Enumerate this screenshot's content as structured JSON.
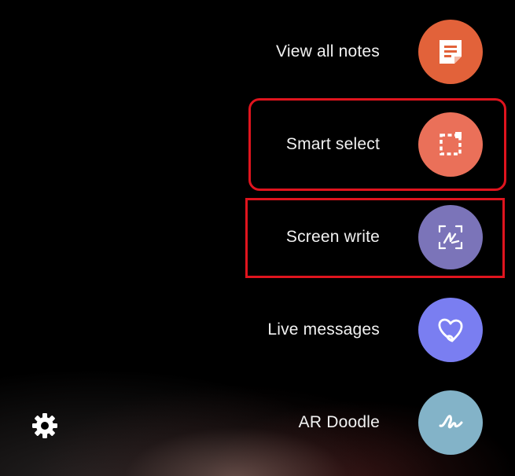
{
  "menu": {
    "items": [
      {
        "label": "View all notes",
        "icon": "notes-icon",
        "color": "#e2623a"
      },
      {
        "label": "Smart select",
        "icon": "smart-select-icon",
        "color": "#ea7059"
      },
      {
        "label": "Screen write",
        "icon": "screen-write-icon",
        "color": "#7b74b9"
      },
      {
        "label": "Live messages",
        "icon": "heart-icon",
        "color": "#7a7ef1"
      },
      {
        "label": "AR Doodle",
        "icon": "doodle-icon",
        "color": "#83b3c8"
      }
    ]
  },
  "settings": {
    "icon": "gear-icon",
    "color": "#ffffff"
  },
  "highlight": {
    "color": "#e0141e"
  }
}
